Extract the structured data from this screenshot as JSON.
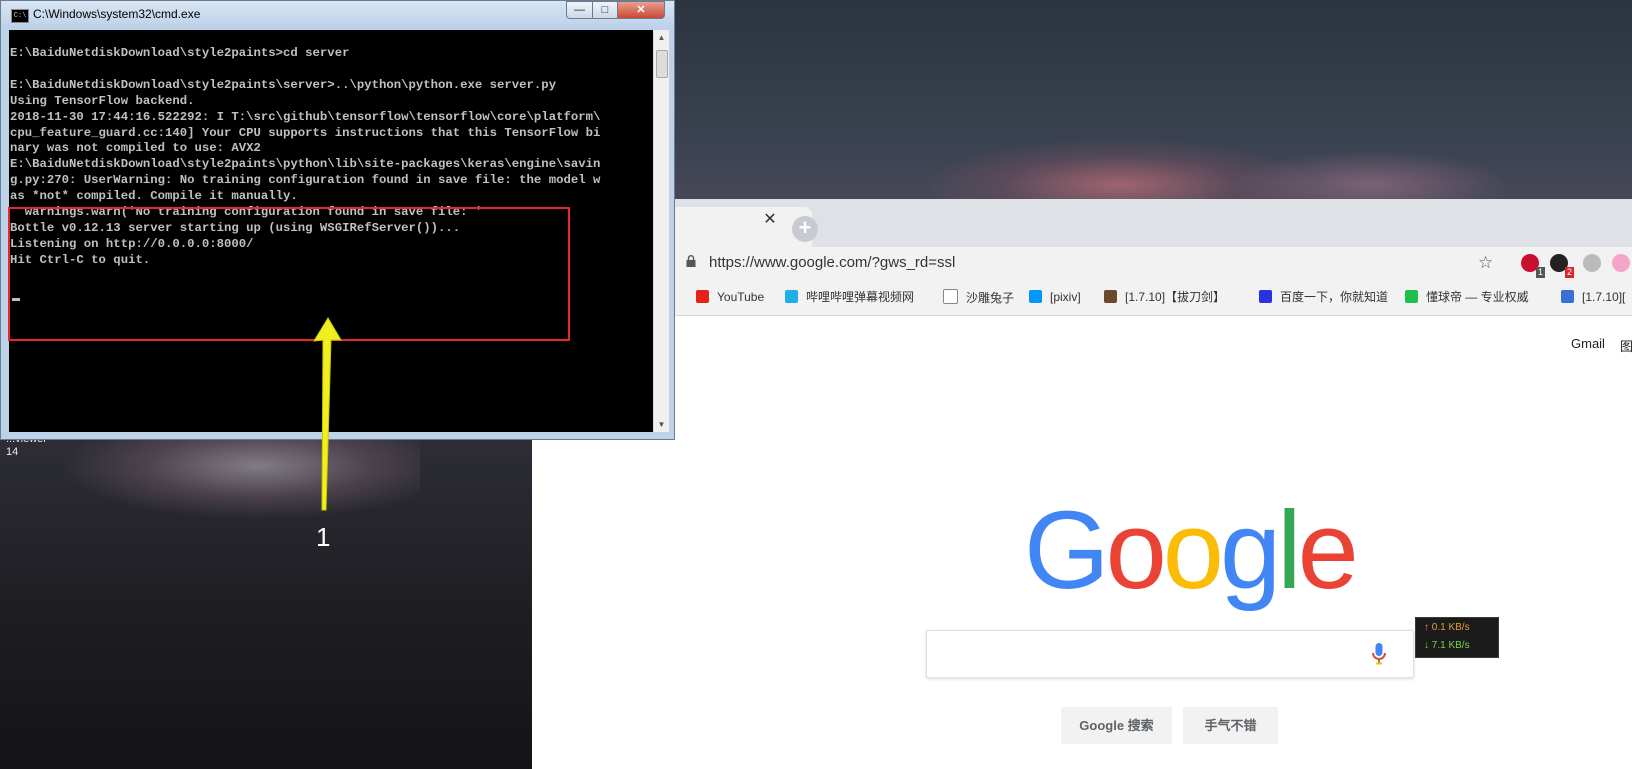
{
  "desktop": {
    "label_line1": "...viewer",
    "label_line2": "14"
  },
  "cmd_window": {
    "title": "C:\\Windows\\system32\\cmd.exe",
    "icon_text": "C:\\",
    "minimize": "—",
    "maximize": "□",
    "close": "✕",
    "console_lines": [
      "E:\\BaiduNetdiskDownload\\style2paints>cd server",
      "",
      "E:\\BaiduNetdiskDownload\\style2paints\\server>..\\python\\python.exe server.py",
      "Using TensorFlow backend.",
      "2018-11-30 17:44:16.522292: I T:\\src\\github\\tensorflow\\tensorflow\\core\\platform\\",
      "cpu_feature_guard.cc:140] Your CPU supports instructions that this TensorFlow bi",
      "nary was not compiled to use: AVX2",
      "E:\\BaiduNetdiskDownload\\style2paints\\python\\lib\\site-packages\\keras\\engine\\savin",
      "g.py:270: UserWarning: No training configuration found in save file: the model w",
      "as *not* compiled. Compile it manually.",
      "  warnings.warn('No training configuration found in save file: '",
      "Bottle v0.12.13 server starting up (using WSGIRefServer())...",
      "Listening on http://0.0.0.0:8000/",
      "Hit Ctrl-C to quit."
    ]
  },
  "annotation": {
    "label": "1",
    "box_color": "#e8262e",
    "arrow_color": "#f0f020"
  },
  "browser": {
    "tab_close": "✕",
    "new_tab": "+",
    "url": "https://www.google.com/?gws_rd=ssl",
    "star_icon": "☆",
    "extensions": [
      {
        "name": "abp-icon",
        "badge": "1",
        "color": "#c8102e"
      },
      {
        "name": "extension-icon",
        "badge": "2",
        "color": "#222222"
      },
      {
        "name": "m-extension-icon",
        "badge": "",
        "color": "#bbbbbb"
      },
      {
        "name": "pink-extension-icon",
        "badge": "",
        "color": "#f4a6c8"
      }
    ],
    "bookmarks": [
      {
        "label": "YouTube",
        "icon": "youtube-icon",
        "color": "#e62117"
      },
      {
        "label": "哔哩哔哩弹幕视频网",
        "icon": "bilibili-icon",
        "color": "#23ade5"
      },
      {
        "label": "沙雕兔子",
        "icon": "page-icon",
        "color": "#ffffff"
      },
      {
        "label": "[pixiv]",
        "icon": "pixiv-icon",
        "color": "#0096fa"
      },
      {
        "label": "[1.7.10]【拔刀剑】",
        "icon": "minecraft-icon",
        "color": "#6b4a2b"
      },
      {
        "label": "百度一下，你就知道",
        "icon": "baidu-icon",
        "color": "#2932e1"
      },
      {
        "label": "懂球帝 — 专业权威",
        "icon": "dongqiudi-icon",
        "color": "#1fbf4f"
      },
      {
        "label": "[1.7.10][",
        "icon": "mcmod-icon",
        "color": "#3a6fd8"
      }
    ],
    "header": {
      "gmail": "Gmail",
      "images": "图"
    },
    "logo": {
      "letters": [
        "G",
        "o",
        "o",
        "g",
        "l",
        "e"
      ],
      "colors": [
        "#4285f4",
        "#ea4335",
        "#fbbc05",
        "#4285f4",
        "#34a853",
        "#ea4335"
      ]
    },
    "search": {
      "value": "",
      "placeholder": "",
      "search_button": "Google 搜索",
      "lucky_button": "手气不错"
    }
  },
  "netspeed": {
    "up": "↑ 0.1 KB/s",
    "down": "↓ 7.1 KB/s"
  }
}
